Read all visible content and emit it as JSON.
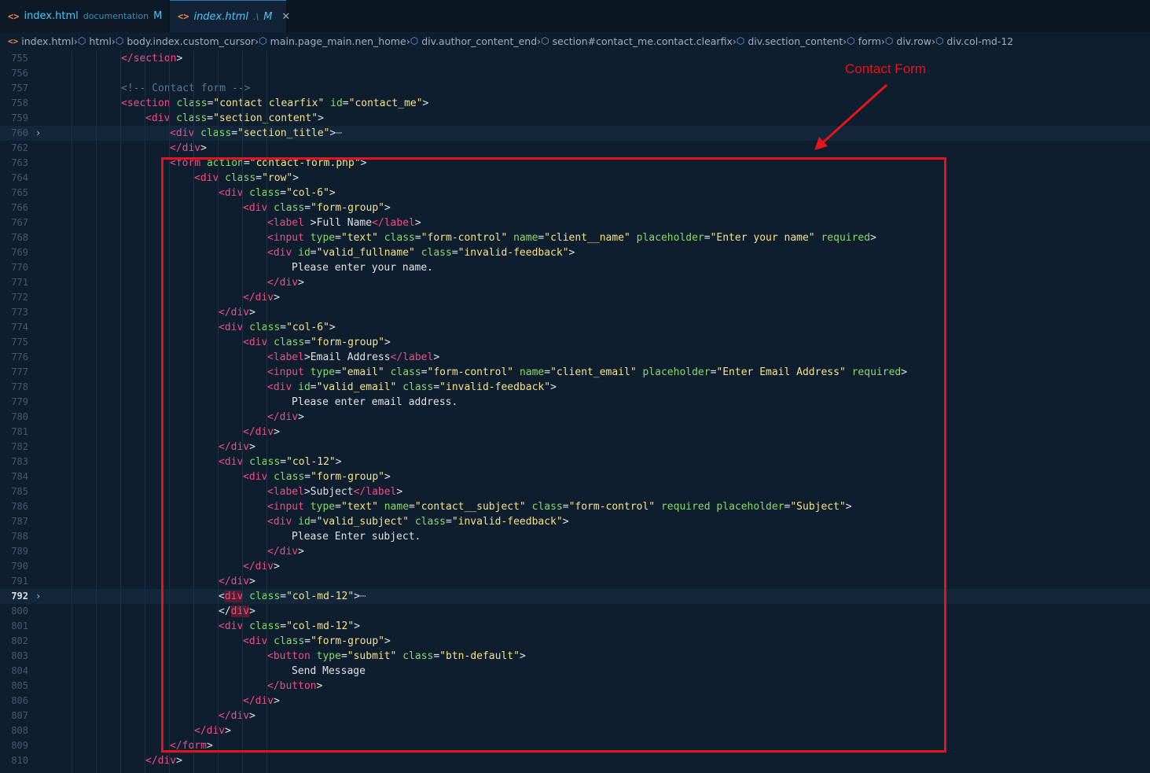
{
  "tabs": [
    {
      "name": "index.html",
      "path": "documentation",
      "status": "M",
      "active": false
    },
    {
      "name": "index.html",
      "path": ".\\",
      "status": "M",
      "active": true,
      "close": "✕"
    }
  ],
  "breadcrumb": [
    "index.html",
    "html",
    "body.index.custom_cursor",
    "main.page_main.nen_home",
    "div.author_content_end",
    "section#contact_me.contact.clearfix",
    "div.section_content",
    "form",
    "div.row",
    "div.col-md-12"
  ],
  "annotation": {
    "label": "Contact Form",
    "color": "#e3141c"
  },
  "lines": [
    {
      "n": "755",
      "indent": 3,
      "code": [
        [
          "t",
          "</section"
        ],
        [
          "p",
          ">"
        ]
      ]
    },
    {
      "n": "756",
      "indent": 0,
      "code": []
    },
    {
      "n": "757",
      "indent": 3,
      "code": [
        [
          "c",
          "<!-- Contact form -->"
        ]
      ]
    },
    {
      "n": "758",
      "indent": 3,
      "code": [
        [
          "t",
          "<section"
        ],
        [
          "p",
          " "
        ],
        [
          "a",
          "class"
        ],
        [
          "p",
          "="
        ],
        [
          "v",
          "\"contact clearfix\""
        ],
        [
          "p",
          " "
        ],
        [
          "a",
          "id"
        ],
        [
          "p",
          "="
        ],
        [
          "v",
          "\"contact_me\""
        ],
        [
          "p",
          ">"
        ]
      ]
    },
    {
      "n": "759",
      "indent": 4,
      "code": [
        [
          "t",
          "<div"
        ],
        [
          "p",
          " "
        ],
        [
          "a",
          "class"
        ],
        [
          "p",
          "="
        ],
        [
          "v",
          "\"section_content\""
        ],
        [
          "p",
          ">"
        ]
      ]
    },
    {
      "n": "760",
      "indent": 5,
      "fold": true,
      "hl": true,
      "code": [
        [
          "t",
          "<div"
        ],
        [
          "p",
          " "
        ],
        [
          "a",
          "class"
        ],
        [
          "p",
          "="
        ],
        [
          "v",
          "\"section_title\""
        ],
        [
          "p",
          ">"
        ],
        [
          "ell",
          "⋯"
        ]
      ]
    },
    {
      "n": "762",
      "indent": 5,
      "code": [
        [
          "t",
          "</div"
        ],
        [
          "p",
          ">"
        ]
      ]
    },
    {
      "n": "763",
      "indent": 5,
      "code": [
        [
          "t",
          "<form"
        ],
        [
          "p",
          " "
        ],
        [
          "a",
          "action"
        ],
        [
          "p",
          "="
        ],
        [
          "v",
          "\"contact-form.php\""
        ],
        [
          "p",
          ">"
        ]
      ]
    },
    {
      "n": "764",
      "indent": 6,
      "code": [
        [
          "t",
          "<div"
        ],
        [
          "p",
          " "
        ],
        [
          "a",
          "class"
        ],
        [
          "p",
          "="
        ],
        [
          "v",
          "\"row\""
        ],
        [
          "p",
          ">"
        ]
      ]
    },
    {
      "n": "765",
      "indent": 7,
      "code": [
        [
          "t",
          "<div"
        ],
        [
          "p",
          " "
        ],
        [
          "a",
          "class"
        ],
        [
          "p",
          "="
        ],
        [
          "v",
          "\"col-6\""
        ],
        [
          "p",
          ">"
        ]
      ]
    },
    {
      "n": "766",
      "indent": 8,
      "code": [
        [
          "t",
          "<div"
        ],
        [
          "p",
          " "
        ],
        [
          "a",
          "class"
        ],
        [
          "p",
          "="
        ],
        [
          "v",
          "\"form-group\""
        ],
        [
          "p",
          ">"
        ]
      ]
    },
    {
      "n": "767",
      "indent": 9,
      "code": [
        [
          "t",
          "<label"
        ],
        [
          "p",
          " >"
        ],
        [
          "txt",
          "Full Name"
        ],
        [
          "t",
          "</label"
        ],
        [
          "p",
          ">"
        ]
      ]
    },
    {
      "n": "768",
      "indent": 9,
      "code": [
        [
          "t",
          "<input"
        ],
        [
          "p",
          " "
        ],
        [
          "a",
          "type"
        ],
        [
          "p",
          "="
        ],
        [
          "v",
          "\"text\""
        ],
        [
          "p",
          " "
        ],
        [
          "a",
          "class"
        ],
        [
          "p",
          "="
        ],
        [
          "v",
          "\"form-control\""
        ],
        [
          "p",
          " "
        ],
        [
          "a",
          "name"
        ],
        [
          "p",
          "="
        ],
        [
          "v",
          "\"client__name\""
        ],
        [
          "p",
          " "
        ],
        [
          "a",
          "placeholder"
        ],
        [
          "p",
          "="
        ],
        [
          "v",
          "\"Enter your name\""
        ],
        [
          "p",
          " "
        ],
        [
          "a",
          "required"
        ],
        [
          "p",
          ">"
        ]
      ]
    },
    {
      "n": "769",
      "indent": 9,
      "code": [
        [
          "t",
          "<div"
        ],
        [
          "p",
          " "
        ],
        [
          "a",
          "id"
        ],
        [
          "p",
          "="
        ],
        [
          "v",
          "\"valid_fullname\""
        ],
        [
          "p",
          " "
        ],
        [
          "a",
          "class"
        ],
        [
          "p",
          "="
        ],
        [
          "v",
          "\"invalid-feedback\""
        ],
        [
          "p",
          ">"
        ]
      ]
    },
    {
      "n": "770",
      "indent": 10,
      "code": [
        [
          "txt",
          "Please enter your name."
        ]
      ]
    },
    {
      "n": "771",
      "indent": 9,
      "code": [
        [
          "t",
          "</div"
        ],
        [
          "p",
          ">"
        ]
      ]
    },
    {
      "n": "772",
      "indent": 8,
      "code": [
        [
          "t",
          "</div"
        ],
        [
          "p",
          ">"
        ]
      ]
    },
    {
      "n": "773",
      "indent": 7,
      "code": [
        [
          "t",
          "</div"
        ],
        [
          "p",
          ">"
        ]
      ]
    },
    {
      "n": "774",
      "indent": 7,
      "code": [
        [
          "t",
          "<div"
        ],
        [
          "p",
          " "
        ],
        [
          "a",
          "class"
        ],
        [
          "p",
          "="
        ],
        [
          "v",
          "\"col-6\""
        ],
        [
          "p",
          ">"
        ]
      ]
    },
    {
      "n": "775",
      "indent": 8,
      "code": [
        [
          "t",
          "<div"
        ],
        [
          "p",
          " "
        ],
        [
          "a",
          "class"
        ],
        [
          "p",
          "="
        ],
        [
          "v",
          "\"form-group\""
        ],
        [
          "p",
          ">"
        ]
      ]
    },
    {
      "n": "776",
      "indent": 9,
      "code": [
        [
          "t",
          "<label"
        ],
        [
          "p",
          ">"
        ],
        [
          "txt",
          "Email Address"
        ],
        [
          "t",
          "</label"
        ],
        [
          "p",
          ">"
        ]
      ]
    },
    {
      "n": "777",
      "indent": 9,
      "code": [
        [
          "t",
          "<input"
        ],
        [
          "p",
          " "
        ],
        [
          "a",
          "type"
        ],
        [
          "p",
          "="
        ],
        [
          "v",
          "\"email\""
        ],
        [
          "p",
          " "
        ],
        [
          "a",
          "class"
        ],
        [
          "p",
          "="
        ],
        [
          "v",
          "\"form-control\""
        ],
        [
          "p",
          " "
        ],
        [
          "a",
          "name"
        ],
        [
          "p",
          "="
        ],
        [
          "v",
          "\"client_email\""
        ],
        [
          "p",
          " "
        ],
        [
          "a",
          "placeholder"
        ],
        [
          "p",
          "="
        ],
        [
          "v",
          "\"Enter Email Address\""
        ],
        [
          "p",
          " "
        ],
        [
          "a",
          "required"
        ],
        [
          "p",
          ">"
        ]
      ]
    },
    {
      "n": "778",
      "indent": 9,
      "code": [
        [
          "t",
          "<div"
        ],
        [
          "p",
          " "
        ],
        [
          "a",
          "id"
        ],
        [
          "p",
          "="
        ],
        [
          "v",
          "\"valid_email\""
        ],
        [
          "p",
          " "
        ],
        [
          "a",
          "class"
        ],
        [
          "p",
          "="
        ],
        [
          "v",
          "\"invalid-feedback\""
        ],
        [
          "p",
          ">"
        ]
      ]
    },
    {
      "n": "779",
      "indent": 10,
      "code": [
        [
          "txt",
          "Please enter email address."
        ]
      ]
    },
    {
      "n": "780",
      "indent": 9,
      "code": [
        [
          "t",
          "</div"
        ],
        [
          "p",
          ">"
        ]
      ]
    },
    {
      "n": "781",
      "indent": 8,
      "code": [
        [
          "t",
          "</div"
        ],
        [
          "p",
          ">"
        ]
      ]
    },
    {
      "n": "782",
      "indent": 7,
      "code": [
        [
          "t",
          "</div"
        ],
        [
          "p",
          ">"
        ]
      ]
    },
    {
      "n": "783",
      "indent": 7,
      "code": [
        [
          "t",
          "<div"
        ],
        [
          "p",
          " "
        ],
        [
          "a",
          "class"
        ],
        [
          "p",
          "="
        ],
        [
          "v",
          "\"col-12\""
        ],
        [
          "p",
          ">"
        ]
      ]
    },
    {
      "n": "784",
      "indent": 8,
      "code": [
        [
          "t",
          "<div"
        ],
        [
          "p",
          " "
        ],
        [
          "a",
          "class"
        ],
        [
          "p",
          "="
        ],
        [
          "v",
          "\"form-group\""
        ],
        [
          "p",
          ">"
        ]
      ]
    },
    {
      "n": "785",
      "indent": 9,
      "code": [
        [
          "t",
          "<label"
        ],
        [
          "p",
          ">"
        ],
        [
          "txt",
          "Subject"
        ],
        [
          "t",
          "</label"
        ],
        [
          "p",
          ">"
        ]
      ]
    },
    {
      "n": "786",
      "indent": 9,
      "code": [
        [
          "t",
          "<input"
        ],
        [
          "p",
          " "
        ],
        [
          "a",
          "type"
        ],
        [
          "p",
          "="
        ],
        [
          "v",
          "\"text\""
        ],
        [
          "p",
          " "
        ],
        [
          "a",
          "name"
        ],
        [
          "p",
          "="
        ],
        [
          "v",
          "\"contact__subject\""
        ],
        [
          "p",
          " "
        ],
        [
          "a",
          "class"
        ],
        [
          "p",
          "="
        ],
        [
          "v",
          "\"form-control\""
        ],
        [
          "p",
          " "
        ],
        [
          "a",
          "required"
        ],
        [
          "p",
          " "
        ],
        [
          "a",
          "placeholder"
        ],
        [
          "p",
          "="
        ],
        [
          "v",
          "\"Subject\""
        ],
        [
          "p",
          ">"
        ]
      ]
    },
    {
      "n": "787",
      "indent": 9,
      "code": [
        [
          "t",
          "<div"
        ],
        [
          "p",
          " "
        ],
        [
          "a",
          "id"
        ],
        [
          "p",
          "="
        ],
        [
          "v",
          "\"valid_subject\""
        ],
        [
          "p",
          " "
        ],
        [
          "a",
          "class"
        ],
        [
          "p",
          "="
        ],
        [
          "v",
          "\"invalid-feedback\""
        ],
        [
          "p",
          ">"
        ]
      ]
    },
    {
      "n": "788",
      "indent": 10,
      "code": [
        [
          "txt",
          "Please Enter subject."
        ]
      ]
    },
    {
      "n": "789",
      "indent": 9,
      "code": [
        [
          "t",
          "</div"
        ],
        [
          "p",
          ">"
        ]
      ]
    },
    {
      "n": "790",
      "indent": 8,
      "code": [
        [
          "t",
          "</div"
        ],
        [
          "p",
          ">"
        ]
      ]
    },
    {
      "n": "791",
      "indent": 7,
      "code": [
        [
          "t",
          "</div"
        ],
        [
          "p",
          ">"
        ]
      ]
    },
    {
      "n": "792",
      "indent": 7,
      "fold": true,
      "hl": true,
      "cur": true,
      "code": [
        [
          "p",
          "<"
        ],
        [
          "tm",
          "div"
        ],
        [
          "p",
          " "
        ],
        [
          "a",
          "class"
        ],
        [
          "p",
          "="
        ],
        [
          "v",
          "\"col-md-12\""
        ],
        [
          "p",
          ">"
        ],
        [
          "ell",
          "⋯"
        ]
      ]
    },
    {
      "n": "800",
      "indent": 7,
      "code": [
        [
          "p",
          "</"
        ],
        [
          "tm",
          "div"
        ],
        [
          "p",
          ">"
        ]
      ]
    },
    {
      "n": "801",
      "indent": 7,
      "code": [
        [
          "t",
          "<div"
        ],
        [
          "p",
          " "
        ],
        [
          "a",
          "class"
        ],
        [
          "p",
          "="
        ],
        [
          "v",
          "\"col-md-12\""
        ],
        [
          "p",
          ">"
        ]
      ]
    },
    {
      "n": "802",
      "indent": 8,
      "code": [
        [
          "t",
          "<div"
        ],
        [
          "p",
          " "
        ],
        [
          "a",
          "class"
        ],
        [
          "p",
          "="
        ],
        [
          "v",
          "\"form-group\""
        ],
        [
          "p",
          ">"
        ]
      ]
    },
    {
      "n": "803",
      "indent": 9,
      "code": [
        [
          "t",
          "<button"
        ],
        [
          "p",
          " "
        ],
        [
          "a",
          "type"
        ],
        [
          "p",
          "="
        ],
        [
          "v",
          "\"submit\""
        ],
        [
          "p",
          " "
        ],
        [
          "a",
          "class"
        ],
        [
          "p",
          "="
        ],
        [
          "v",
          "\"btn-default\""
        ],
        [
          "p",
          ">"
        ]
      ]
    },
    {
      "n": "804",
      "indent": 10,
      "code": [
        [
          "txt",
          "Send Message"
        ]
      ]
    },
    {
      "n": "805",
      "indent": 9,
      "code": [
        [
          "t",
          "</button"
        ],
        [
          "p",
          ">"
        ]
      ]
    },
    {
      "n": "806",
      "indent": 8,
      "code": [
        [
          "t",
          "</div"
        ],
        [
          "p",
          ">"
        ]
      ]
    },
    {
      "n": "807",
      "indent": 7,
      "code": [
        [
          "t",
          "</div"
        ],
        [
          "p",
          ">"
        ]
      ]
    },
    {
      "n": "808",
      "indent": 6,
      "code": [
        [
          "t",
          "</div"
        ],
        [
          "p",
          ">"
        ]
      ]
    },
    {
      "n": "809",
      "indent": 5,
      "code": [
        [
          "t",
          "</form"
        ],
        [
          "p",
          ">"
        ]
      ]
    },
    {
      "n": "810",
      "indent": 4,
      "code": [
        [
          "t",
          "</div"
        ],
        [
          "p",
          ">"
        ]
      ]
    }
  ]
}
